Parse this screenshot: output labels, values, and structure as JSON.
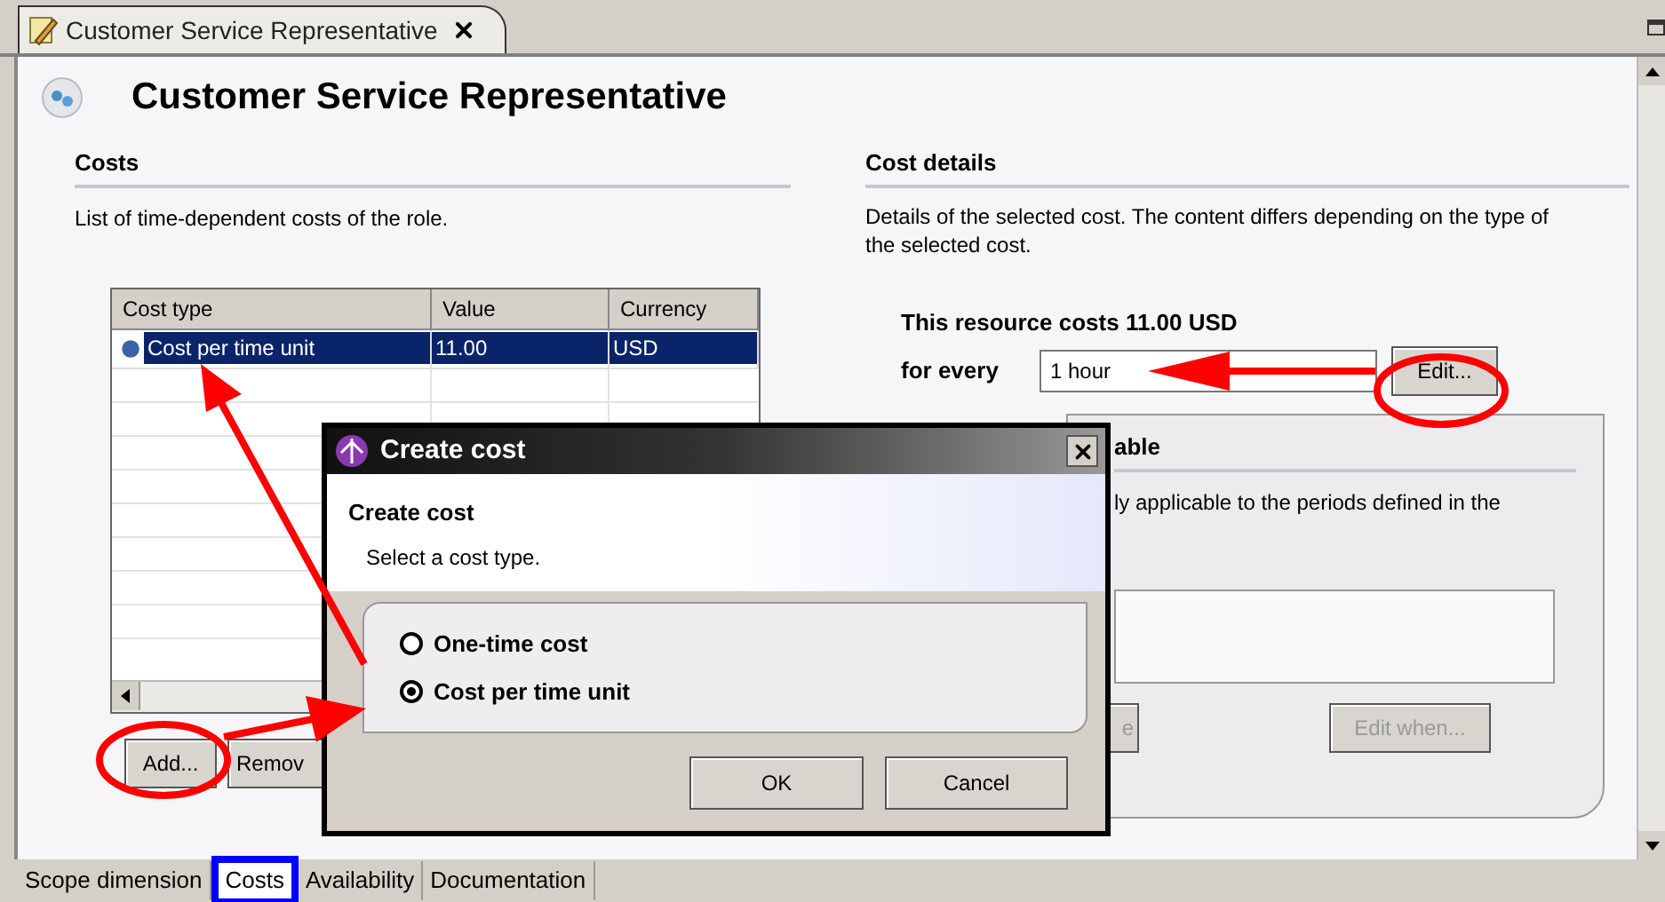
{
  "editor_tab": {
    "title": "Customer Service Representative"
  },
  "header": {
    "title": "Customer Service Representative"
  },
  "costs": {
    "heading": "Costs",
    "description": "List of time-dependent costs of the role.",
    "table": {
      "columns": [
        "Cost type",
        "Value",
        "Currency"
      ],
      "rows": [
        {
          "cells": [
            "Cost per time unit",
            "11.00",
            "USD"
          ],
          "selected": true
        }
      ]
    },
    "buttons": [
      "Add...",
      "Remov"
    ]
  },
  "cost_details": {
    "heading": "Cost details",
    "description": "Details of the selected cost. The content differs depending on the type of the selected cost.",
    "summary": "This resource costs 11.00 USD",
    "for_label": "for every",
    "for_value": "1 hour",
    "edit_button": "Edit...",
    "applicability": {
      "heading": "able",
      "text": "ly applicable to the periods defined in the",
      "buttons": [
        {
          "label": "e",
          "disabled": true
        },
        {
          "label": "Edit when...",
          "disabled": true
        }
      ]
    }
  },
  "dialog": {
    "title": "Create cost",
    "heading": "Create cost",
    "message": "Select a cost type.",
    "options": [
      {
        "label": "One-time cost",
        "selected": false
      },
      {
        "label": "Cost per time unit",
        "selected": true
      }
    ],
    "buttons": [
      "OK",
      "Cancel"
    ]
  },
  "bottom_tabs": [
    {
      "label": "Scope dimension",
      "selected": false
    },
    {
      "label": "Costs",
      "selected": true
    },
    {
      "label": "Availability",
      "selected": false
    },
    {
      "label": "Documentation",
      "selected": false
    }
  ]
}
